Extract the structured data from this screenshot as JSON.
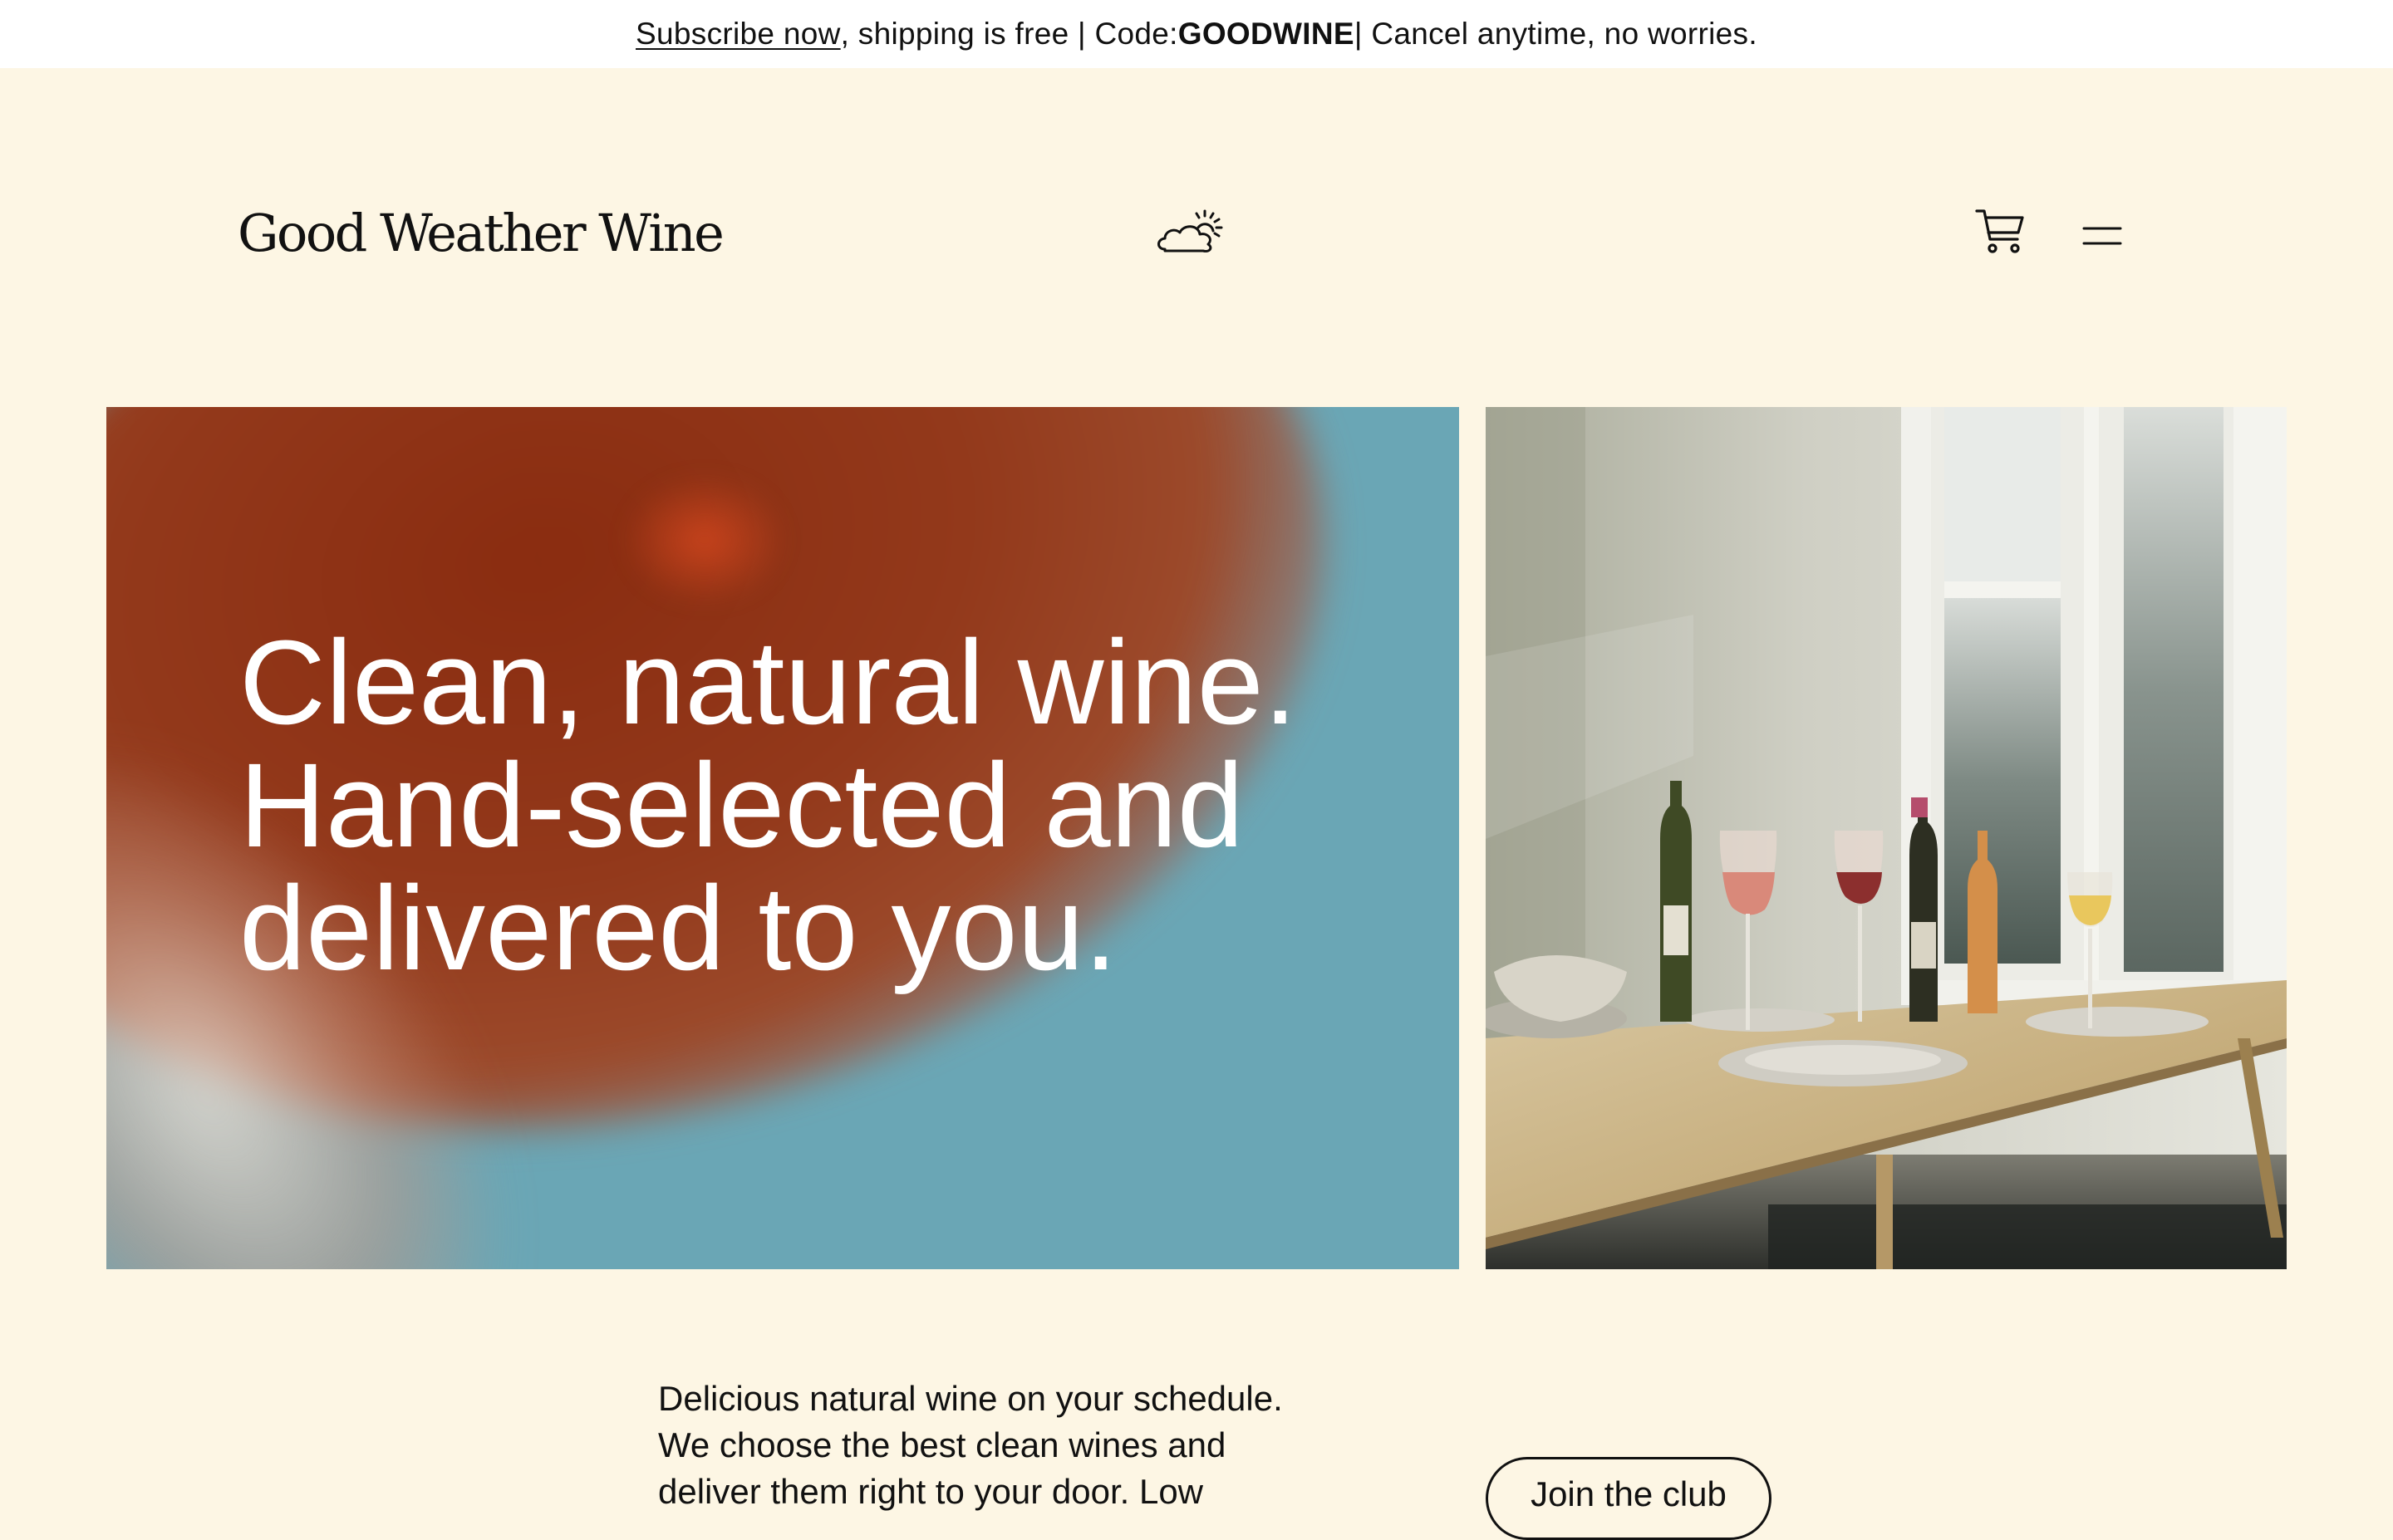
{
  "announcement": {
    "link_text": "Subscribe now",
    "middle_text": ", shipping is free | Code: ",
    "code": "GOODWINE",
    "end_text": " | Cancel anytime, no worries."
  },
  "header": {
    "logo": "Good Weather Wine",
    "center_icon": "cloud-sun-icon",
    "cart_icon": "cart-icon",
    "menu_icon": "hamburger-menu-icon"
  },
  "hero": {
    "title_lines": [
      "Clean, natural wine.",
      "Hand-selected and",
      "delivered to you."
    ]
  },
  "intro": {
    "lines": [
      "Delicious natural wine on your schedule.",
      "We choose the best clean wines and",
      "deliver them right to your door. Low"
    ],
    "cta_label": "Join the club"
  },
  "colors": {
    "background": "#fdf6e4",
    "announcement_bg": "#ffffff",
    "hero_blue": "#6aa6b5",
    "hero_red": "#8a2c10",
    "text": "#111111"
  }
}
